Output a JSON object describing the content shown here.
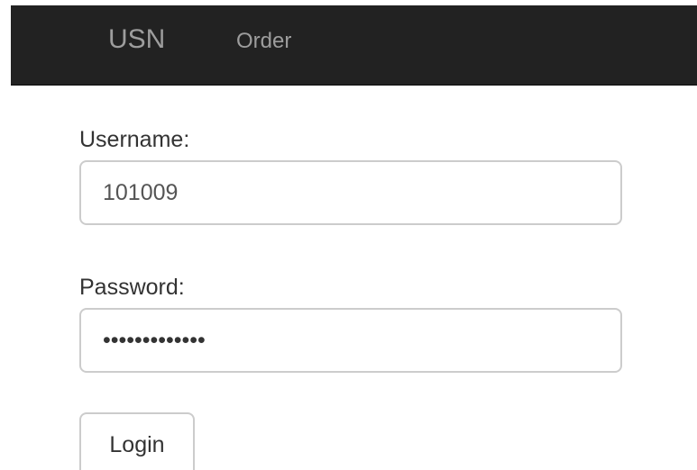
{
  "navbar": {
    "brand": "USN",
    "links": [
      {
        "label": "Order"
      }
    ]
  },
  "login_form": {
    "username_label": "Username:",
    "username_value": "101009",
    "password_label": "Password:",
    "password_value": "•••••••••••••",
    "login_button_label": "Login"
  }
}
